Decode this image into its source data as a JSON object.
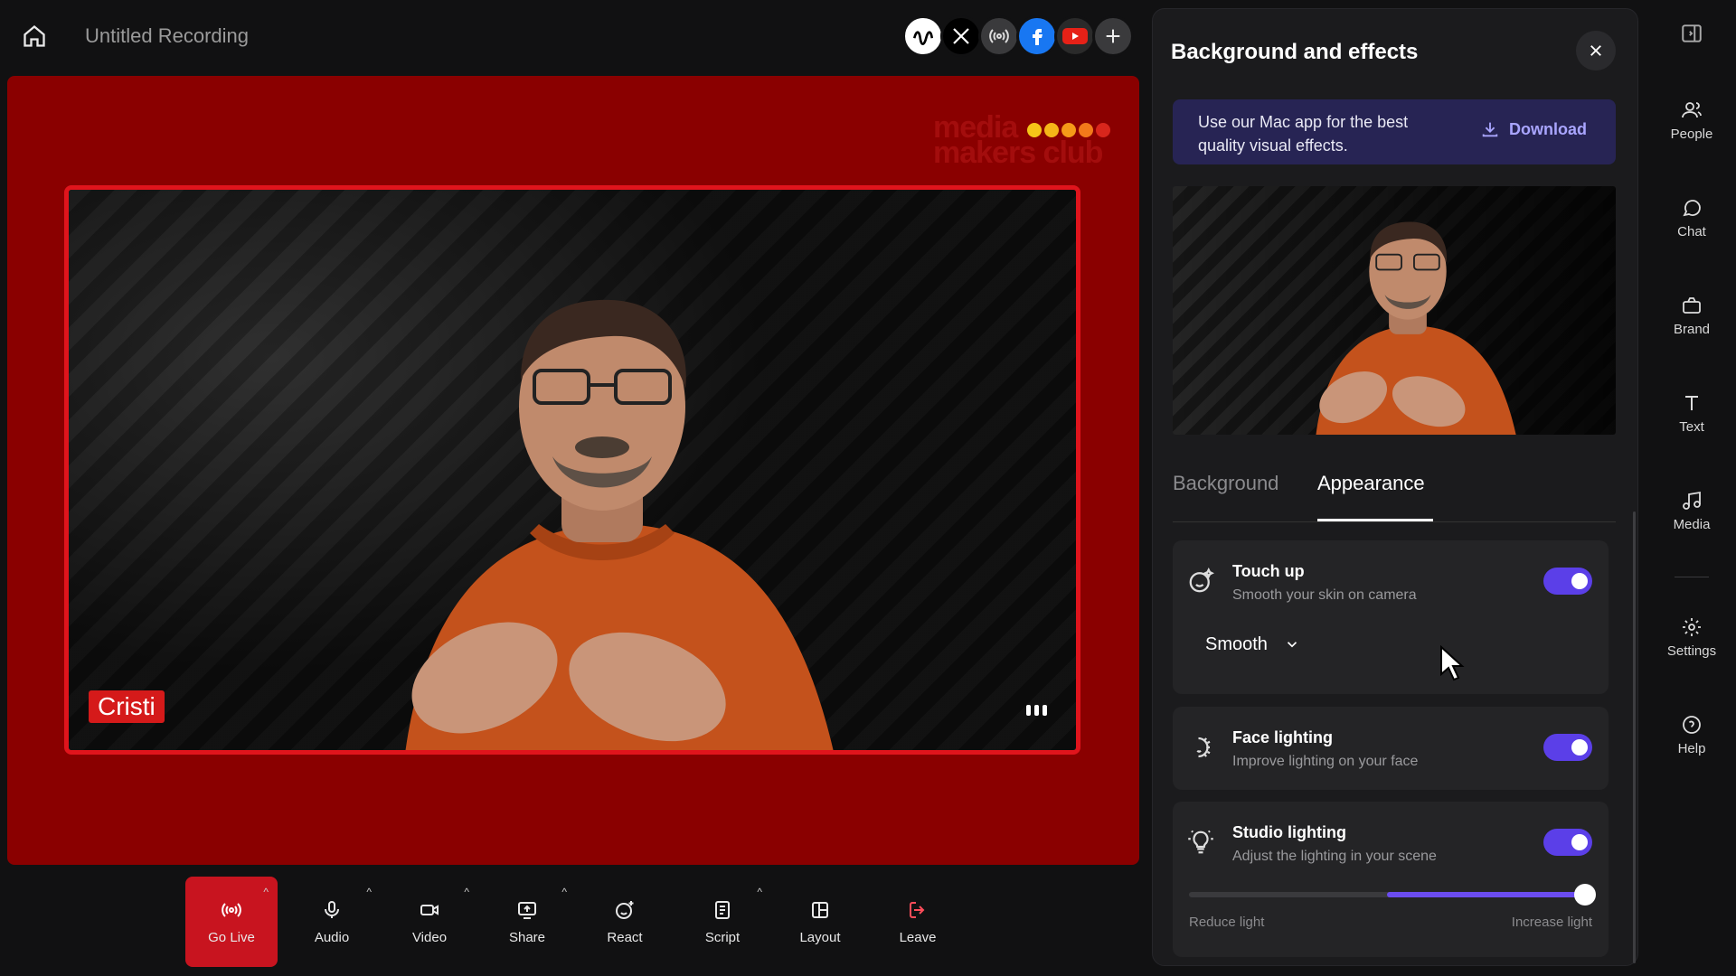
{
  "topbar": {
    "title": "Untitled Recording",
    "destinations": [
      "wave-icon",
      "x-logo-icon",
      "podcast-icon",
      "facebook-icon",
      "youtube-icon",
      "plus-icon"
    ]
  },
  "stage": {
    "brand_line1": "media",
    "brand_line2": "makers club",
    "brand_dots": [
      "#f5c518",
      "#f5b618",
      "#f59a18",
      "#f27a1a",
      "#d9261c"
    ],
    "participant_name": "Cristi"
  },
  "toolbar": {
    "go_live": "Go Live",
    "audio": "Audio",
    "video": "Video",
    "share": "Share",
    "react": "React",
    "script": "Script",
    "layout": "Layout",
    "leave": "Leave"
  },
  "panel": {
    "title": "Background and effects",
    "promo_text": "Use our Mac app for the best quality visual effects.",
    "download_label": "Download",
    "tabs": [
      "Background",
      "Appearance"
    ],
    "active_tab": "Appearance",
    "touch_up": {
      "title": "Touch up",
      "subtitle": "Smooth your skin on camera",
      "enabled": true,
      "mode": "Smooth"
    },
    "face_lighting": {
      "title": "Face lighting",
      "subtitle": "Improve lighting on your face",
      "enabled": true
    },
    "studio_lighting": {
      "title": "Studio lighting",
      "subtitle": "Adjust the lighting in your scene",
      "enabled": true,
      "range_start": 0.5,
      "range_end": 1.0,
      "min_label": "Reduce light",
      "max_label": "Increase light"
    }
  },
  "rail": {
    "people": "People",
    "chat": "Chat",
    "brand": "Brand",
    "text": "Text",
    "media": "Media",
    "settings": "Settings",
    "help": "Help"
  },
  "colors": {
    "stage": "#8a0000",
    "frame": "#e0141c",
    "accent": "#5b3fe8",
    "live": "#c8141f"
  }
}
